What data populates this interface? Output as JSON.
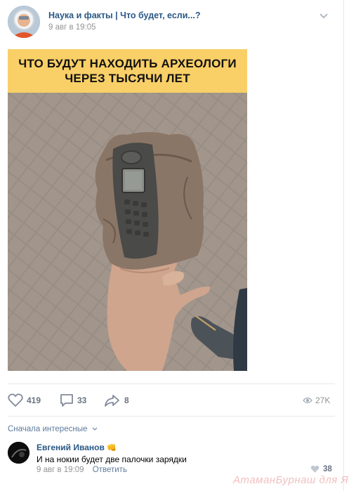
{
  "post": {
    "group_name": "Наука и факты | Что будет, если...?",
    "date": "9 авг в 19:05",
    "image_caption_line1": "ЧТО БУДУТ НАХОДИТЬ АРХЕОЛОГИ",
    "image_caption_line2": "ЧЕРЕЗ ТЫСЯЧИ ЛЕТ"
  },
  "actions": {
    "likes": "419",
    "comments": "33",
    "shares": "8",
    "views": "27K"
  },
  "comments": {
    "sort_label": "Сначала интересные",
    "items": [
      {
        "author": "Евгений Иванов",
        "badge": "👊",
        "text": "И на нокии будет две палочки зарядки",
        "date": "9 авг в 19:09",
        "reply_label": "Ответить",
        "likes": "38"
      }
    ]
  },
  "watermark": "АтаманБурнаш для ЯП",
  "colors": {
    "link": "#2a5885",
    "muted": "#939393",
    "banner": "#f9cf67"
  }
}
